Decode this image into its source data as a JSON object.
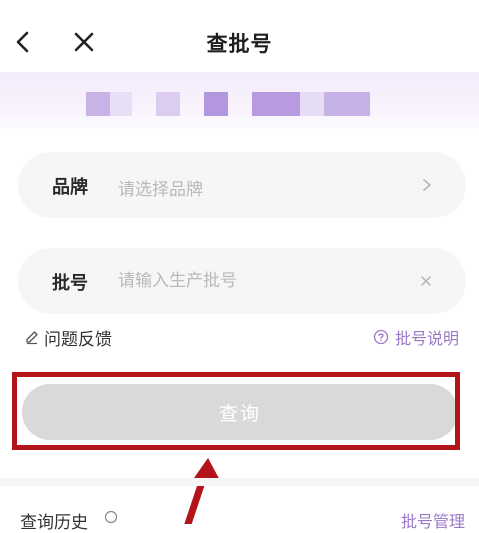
{
  "header": {
    "title": "查批号"
  },
  "banner": {
    "colors": [
      "#c9b3e6",
      "#e8def6",
      "#dccdf0",
      "#b397de",
      "#b89ae0",
      "#e6dcf5",
      "#c6b2e6"
    ]
  },
  "form": {
    "brand": {
      "label": "品牌",
      "placeholder": "请选择品牌"
    },
    "batch": {
      "label": "批号",
      "placeholder": "请输入生产批号"
    }
  },
  "links": {
    "feedback": "问题反馈",
    "explain": "批号说明"
  },
  "query_button": "查询",
  "history": {
    "label": "查询历史",
    "manage": "批号管理"
  },
  "colors": {
    "accent": "#9a78c8",
    "highlight": "#b3141a",
    "button_disabled": "#d9d9d9"
  }
}
